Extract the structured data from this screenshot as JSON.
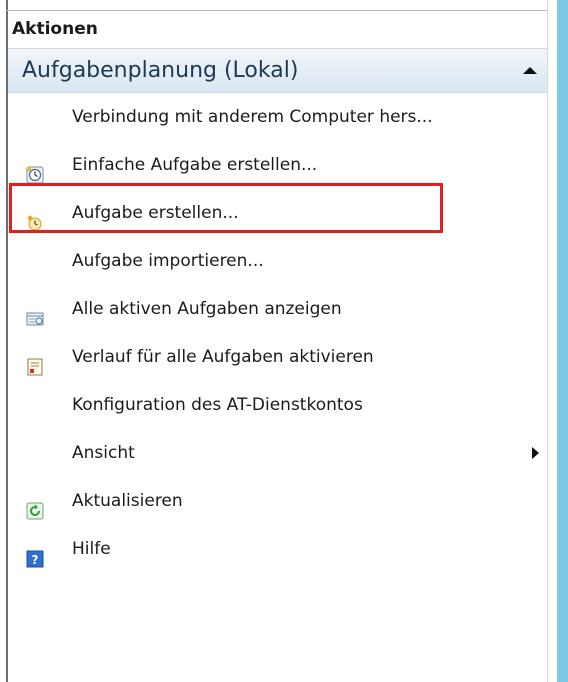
{
  "panel": {
    "title": "Aktionen",
    "section": {
      "label": "Aufgabenplanung (Lokal)",
      "collapse_icon": "triangle-up-icon"
    },
    "items": [
      {
        "label": "Verbindung mit anderem Computer hers...",
        "icon": ""
      },
      {
        "label": "Einfache Aufgabe erstellen...",
        "icon": "simple-task-clock-icon",
        "highlighted": true
      },
      {
        "label": "Aufgabe erstellen...",
        "icon": "create-task-clock-icon"
      },
      {
        "label": "Aufgabe importieren...",
        "icon": ""
      },
      {
        "label": "Alle aktiven Aufgaben anzeigen",
        "icon": "active-tasks-icon"
      },
      {
        "label": "Verlauf für alle Aufgaben aktivieren",
        "icon": "history-icon"
      },
      {
        "label": "Konfiguration des AT-Dienstkontos",
        "icon": ""
      },
      {
        "label": "Ansicht",
        "icon": "",
        "submenu_icon": "triangle-right-icon"
      },
      {
        "label": "Aktualisieren",
        "icon": "refresh-icon"
      },
      {
        "label": "Hilfe",
        "icon": "help-icon"
      }
    ]
  },
  "colors": {
    "highlight_border": "#e02020",
    "section_text": "#1e3954",
    "edge_blue": "#7ec8e8"
  }
}
